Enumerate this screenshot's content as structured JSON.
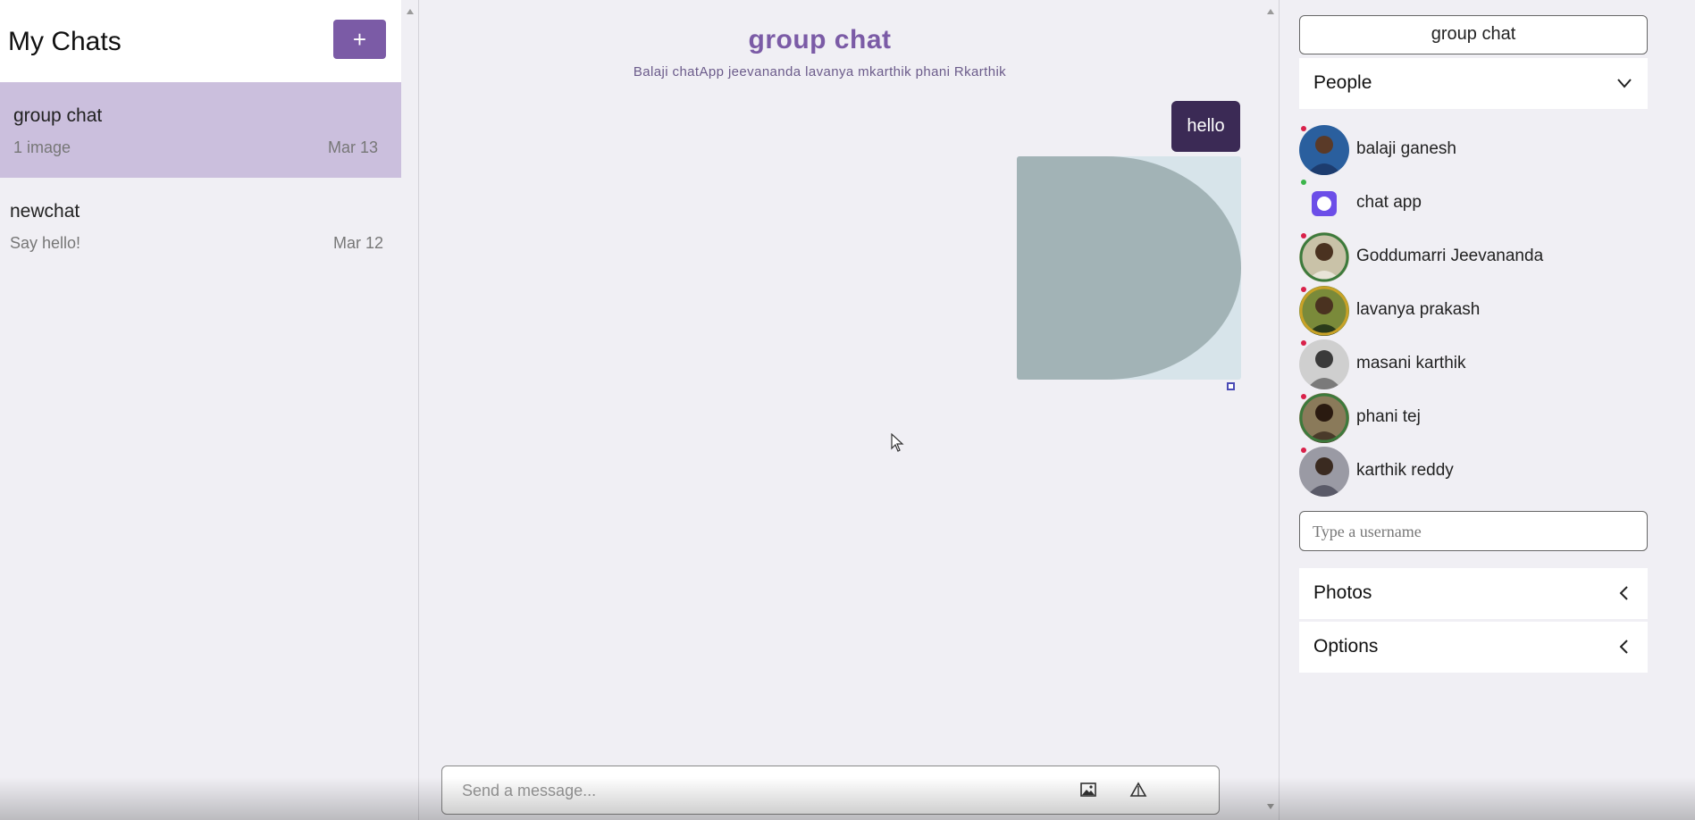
{
  "left": {
    "title": "My Chats",
    "new_chat_label": "+",
    "chats": [
      {
        "title": "group chat",
        "subtitle": "1 image",
        "date": "Mar 13",
        "active": true
      },
      {
        "title": "newchat",
        "subtitle": "Say hello!",
        "date": "Mar 12",
        "active": false
      }
    ]
  },
  "feed": {
    "title": "group chat",
    "members_line": "Balaji chatApp jeevananda lavanya mkarthik phani Rkarthik",
    "messages": [
      {
        "type": "text",
        "text": "hello"
      },
      {
        "type": "image"
      }
    ],
    "compose": {
      "placeholder": "Send a message...",
      "attach_icon": "image-icon",
      "send_icon": "send-icon"
    }
  },
  "settings": {
    "chat_title": "group chat",
    "people_label": "People",
    "people": [
      {
        "name": "balaji ganesh",
        "online": false,
        "avatar_color": "#2a5f9e"
      },
      {
        "name": "chat app",
        "online": true,
        "avatar_color": "#6c4ee8"
      },
      {
        "name": "Goddumarri Jeevananda",
        "online": false,
        "avatar_color": "#7a6a4a"
      },
      {
        "name": "lavanya prakash",
        "online": false,
        "avatar_color": "#4a6a2a"
      },
      {
        "name": "masani karthik",
        "online": false,
        "avatar_color": "#9a9a9a"
      },
      {
        "name": "phani tej",
        "online": false,
        "avatar_color": "#5a4a3a"
      },
      {
        "name": "karthik reddy",
        "online": false,
        "avatar_color": "#6a6a78"
      }
    ],
    "username_placeholder": "Type a username",
    "photos_label": "Photos",
    "options_label": "Options"
  },
  "colors": {
    "accent": "#7b5ba6",
    "active_chat_bg": "#cbbfdd",
    "bubble_bg": "#3b2a55",
    "page_bg": "#f0eff4"
  }
}
